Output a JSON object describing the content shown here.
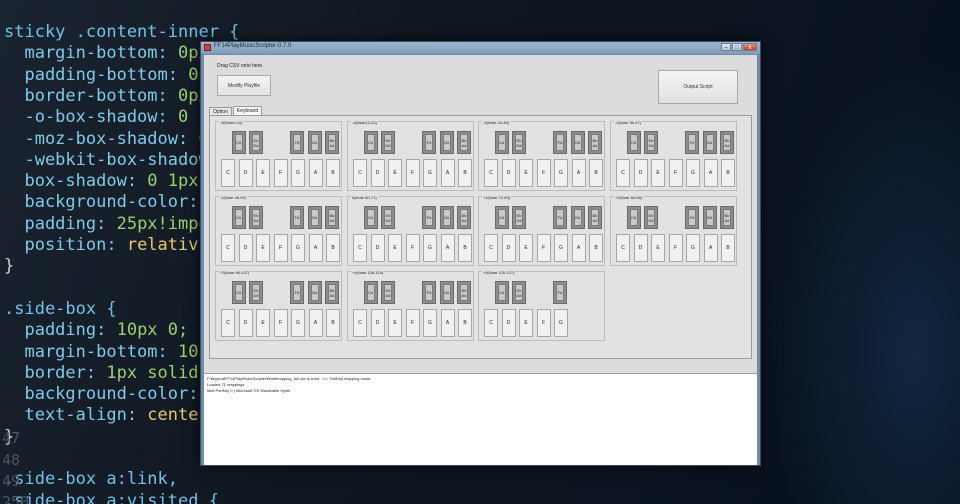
{
  "background_code": {
    "line_numbers": [
      "",
      "",
      "",
      "",
      "",
      "",
      "",
      "",
      "",
      "",
      "",
      "",
      "",
      "",
      "",
      "",
      "",
      "",
      "47",
      "48",
      "49",
      "250",
      "",
      ""
    ],
    "lines": [
      [
        {
          "t": "sticky .content-inner {",
          "c": "c-sel"
        }
      ],
      [
        {
          "t": "  margin-bottom: ",
          "c": "c-prop"
        },
        {
          "t": "0px!",
          "c": "c-num"
        }
      ],
      [
        {
          "t": "  padding-bottom: ",
          "c": "c-prop"
        },
        {
          "t": "0px!",
          "c": "c-num"
        }
      ],
      [
        {
          "t": "  border-bottom: ",
          "c": "c-prop"
        },
        {
          "t": "0px!",
          "c": "c-num"
        }
      ],
      [
        {
          "t": "  -o-box-shadow: ",
          "c": "c-prop"
        },
        {
          "t": "0 1p",
          "c": "c-num"
        }
      ],
      [
        {
          "t": "  -moz-box-shadow: ",
          "c": "c-prop"
        },
        {
          "t": "0 1",
          "c": "c-num"
        }
      ],
      [
        {
          "t": "  -webkit-box-shadow",
          "c": "c-prop"
        }
      ],
      [
        {
          "t": "  box-shadow: ",
          "c": "c-prop"
        },
        {
          "t": "0 1px",
          "c": "c-num"
        }
      ],
      [
        {
          "t": "  background-color: ",
          "c": "c-prop"
        }
      ],
      [
        {
          "t": "  padding: ",
          "c": "c-prop"
        },
        {
          "t": "25px!impo",
          "c": "c-num"
        }
      ],
      [
        {
          "t": "  position: ",
          "c": "c-prop"
        },
        {
          "t": "relativ",
          "c": "c-val"
        }
      ],
      [
        {
          "t": "}",
          "c": "c-pun"
        }
      ],
      [
        {
          "t": "",
          "c": "c-pun"
        }
      ],
      [
        {
          "t": ".side-box {",
          "c": "c-sel"
        }
      ],
      [
        {
          "t": "  padding: ",
          "c": "c-prop"
        },
        {
          "t": "10px 0;",
          "c": "c-num"
        }
      ],
      [
        {
          "t": "  margin-bottom: ",
          "c": "c-prop"
        },
        {
          "t": "10",
          "c": "c-num"
        }
      ],
      [
        {
          "t": "  border: ",
          "c": "c-prop"
        },
        {
          "t": "1px solid",
          "c": "c-num"
        }
      ],
      [
        {
          "t": "  background-color:",
          "c": "c-prop"
        }
      ],
      [
        {
          "t": "  text-align: ",
          "c": "c-prop"
        },
        {
          "t": "cente",
          "c": "c-val"
        }
      ],
      [
        {
          "t": "}",
          "c": "c-pun"
        }
      ],
      [
        {
          "t": "",
          "c": "c-pun"
        }
      ],
      [
        {
          "t": ".side-box a:link,",
          "c": "c-sel"
        }
      ],
      [
        {
          "t": ".side-box a:visited {",
          "c": "c-sel"
        }
      ]
    ]
  },
  "window": {
    "title": "FF14PlayMusicScripter-0.7.0",
    "controls": {
      "minimize": "–",
      "maximize": "□",
      "close": "x"
    }
  },
  "top": {
    "drop_label": "Drag CSV onto here.",
    "modify_button": "Modify Playfile",
    "output_button": "Output Script"
  },
  "tabs": [
    {
      "label": "Option",
      "active": false
    },
    {
      "label": "Keyboard",
      "active": true
    }
  ],
  "octaves": [
    {
      "title": "-5(Note0-11)",
      "naturals": [
        "C",
        "D",
        "E",
        "F",
        "G",
        "A",
        "B"
      ],
      "sharps": [
        {
          "l1": "C#",
          "l2": ""
        },
        {
          "l1": "Eb",
          "l2": "D#"
        },
        {
          "l1": "F#",
          "l2": ""
        },
        {
          "l1": "G#",
          "l2": ""
        },
        {
          "l1": "Bb",
          "l2": "A#"
        }
      ]
    },
    {
      "title": "-4(Note12-23)",
      "naturals": [
        "C",
        "D",
        "E",
        "F",
        "G",
        "A",
        "B"
      ],
      "sharps": [
        {
          "l1": "C#",
          "l2": ""
        },
        {
          "l1": "Eb",
          "l2": "D#"
        },
        {
          "l1": "F#",
          "l2": ""
        },
        {
          "l1": "G#",
          "l2": ""
        },
        {
          "l1": "Bb",
          "l2": "A#"
        }
      ]
    },
    {
      "title": "-3(Note 24-35)",
      "naturals": [
        "C",
        "D",
        "E",
        "F",
        "G",
        "A",
        "B"
      ],
      "sharps": [
        {
          "l1": "C#",
          "l2": ""
        },
        {
          "l1": "Eb",
          "l2": "D#"
        },
        {
          "l1": "F#",
          "l2": ""
        },
        {
          "l1": "G#",
          "l2": ""
        },
        {
          "l1": "Bb",
          "l2": "A#"
        }
      ]
    },
    {
      "title": "-2(Note 36-47)",
      "naturals": [
        "C",
        "D",
        "E",
        "F",
        "G",
        "A",
        "B"
      ],
      "sharps": [
        {
          "l1": "C#",
          "l2": ""
        },
        {
          "l1": "Eb",
          "l2": "D#"
        },
        {
          "l1": "F#",
          "l2": ""
        },
        {
          "l1": "G#",
          "l2": ""
        },
        {
          "l1": "Bb",
          "l2": "A#"
        }
      ]
    },
    {
      "title": "-1(Note 48-59)",
      "naturals": [
        "C",
        "D",
        "E",
        "F",
        "G",
        "A",
        "B"
      ],
      "sharps": [
        {
          "l1": "C#",
          "l2": ""
        },
        {
          "l1": "Eb",
          "l2": "D#"
        },
        {
          "l1": "F#",
          "l2": ""
        },
        {
          "l1": "G#",
          "l2": ""
        },
        {
          "l1": "Bb",
          "l2": "A#"
        }
      ]
    },
    {
      "title": "0(Note 60-71)",
      "naturals": [
        "C",
        "D",
        "E",
        "F",
        "G",
        "A",
        "B"
      ],
      "sharps": [
        {
          "l1": "C#",
          "l2": ""
        },
        {
          "l1": "Eb",
          "l2": "D#"
        },
        {
          "l1": "F#",
          "l2": ""
        },
        {
          "l1": "G#",
          "l2": ""
        },
        {
          "l1": "Bb",
          "l2": "A#"
        }
      ]
    },
    {
      "title": "+1(Note 72-83)",
      "naturals": [
        "C",
        "D",
        "E",
        "F",
        "G",
        "A",
        "B"
      ],
      "sharps": [
        {
          "l1": "C#",
          "l2": ""
        },
        {
          "l1": "Eb",
          "l2": "D#"
        },
        {
          "l1": "F#",
          "l2": ""
        },
        {
          "l1": "G#",
          "l2": ""
        },
        {
          "l1": "Bb",
          "l2": "A#"
        }
      ]
    },
    {
      "title": "+2(Note 84-95)",
      "naturals": [
        "C",
        "D",
        "E",
        "F",
        "G",
        "A",
        "B"
      ],
      "sharps": [
        {
          "l1": "C#",
          "l2": ""
        },
        {
          "l1": "Eb",
          "l2": "D#"
        },
        {
          "l1": "F#",
          "l2": ""
        },
        {
          "l1": "G#",
          "l2": ""
        },
        {
          "l1": "Bb",
          "l2": "A#"
        }
      ]
    },
    {
      "title": "+3(Note 96-107)",
      "naturals": [
        "C",
        "D",
        "E",
        "F",
        "G",
        "A",
        "B"
      ],
      "sharps": [
        {
          "l1": "C#",
          "l2": ""
        },
        {
          "l1": "Eb",
          "l2": "D#"
        },
        {
          "l1": "F#",
          "l2": ""
        },
        {
          "l1": "G#",
          "l2": ""
        },
        {
          "l1": "Bb",
          "l2": "A#"
        }
      ]
    },
    {
      "title": "+4(Note 108-119)",
      "naturals": [
        "C",
        "D",
        "E",
        "F",
        "G",
        "A",
        "B"
      ],
      "sharps": [
        {
          "l1": "C#",
          "l2": ""
        },
        {
          "l1": "Eb",
          "l2": "D#"
        },
        {
          "l1": "F#",
          "l2": ""
        },
        {
          "l1": "G#",
          "l2": ""
        },
        {
          "l1": "Bb",
          "l2": "A#"
        }
      ]
    },
    {
      "title": "+5(Note 120-127)",
      "naturals": [
        "C",
        "D",
        "E",
        "F",
        "G"
      ],
      "sharps": [
        {
          "l1": "C#",
          "l2": ""
        },
        {
          "l1": "Eb",
          "l2": "D#"
        },
        {
          "l1": "F#",
          "l2": ""
        }
      ]
    }
  ],
  "log": [
    "F:¥eypro¥FF14PlayMusicScripter¥bin¥mapping_full.csv is exist. >>> FullKey mapping mode.",
    "Loaded 71 mappings.",
    "Midi PortNo( 0 ) Microsoft GS Wavetable Synth"
  ]
}
